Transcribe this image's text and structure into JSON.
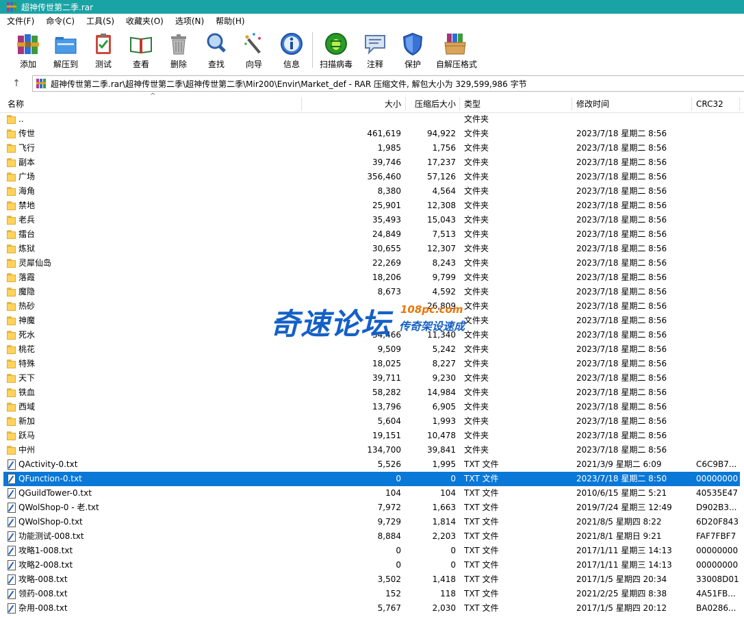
{
  "window": {
    "title": "超神传世第二季.rar"
  },
  "menu": [
    "文件(F)",
    "命令(C)",
    "工具(S)",
    "收藏夹(O)",
    "选项(N)",
    "帮助(H)"
  ],
  "toolbar": {
    "add": "添加",
    "extract_to": "解压到",
    "test": "测试",
    "view": "查看",
    "delete": "删除",
    "find": "查找",
    "wizard": "向导",
    "info": "信息",
    "virus_scan": "扫描病毒",
    "comment": "注释",
    "protect": "保护",
    "sfx": "自解压格式"
  },
  "address": {
    "path": "超神传世第二季.rar\\超神传世第二季\\超神传世第二季\\Mir200\\Envir\\Market_def - RAR 压缩文件, 解包大小为 329,599,986 字节"
  },
  "columns": {
    "name": "名称",
    "size": "大小",
    "packed": "压缩后大小",
    "type": "类型",
    "modified": "修改时间",
    "crc": "CRC32"
  },
  "files": [
    {
      "icon": "folder",
      "name": "..",
      "size": "",
      "packed": "",
      "type": "文件夹",
      "modified": "",
      "crc": ""
    },
    {
      "icon": "folder",
      "name": "传世",
      "size": "461,619",
      "packed": "94,922",
      "type": "文件夹",
      "modified": "2023/7/18 星期二 8:56",
      "crc": ""
    },
    {
      "icon": "folder",
      "name": "飞行",
      "size": "1,985",
      "packed": "1,756",
      "type": "文件夹",
      "modified": "2023/7/18 星期二 8:56",
      "crc": ""
    },
    {
      "icon": "folder",
      "name": "副本",
      "size": "39,746",
      "packed": "17,237",
      "type": "文件夹",
      "modified": "2023/7/18 星期二 8:56",
      "crc": ""
    },
    {
      "icon": "folder",
      "name": "广场",
      "size": "356,460",
      "packed": "57,126",
      "type": "文件夹",
      "modified": "2023/7/18 星期二 8:56",
      "crc": ""
    },
    {
      "icon": "folder",
      "name": "海角",
      "size": "8,380",
      "packed": "4,564",
      "type": "文件夹",
      "modified": "2023/7/18 星期二 8:56",
      "crc": ""
    },
    {
      "icon": "folder",
      "name": "禁地",
      "size": "25,901",
      "packed": "12,308",
      "type": "文件夹",
      "modified": "2023/7/18 星期二 8:56",
      "crc": ""
    },
    {
      "icon": "folder",
      "name": "老兵",
      "size": "35,493",
      "packed": "15,043",
      "type": "文件夹",
      "modified": "2023/7/18 星期二 8:56",
      "crc": ""
    },
    {
      "icon": "folder",
      "name": "擂台",
      "size": "24,849",
      "packed": "7,513",
      "type": "文件夹",
      "modified": "2023/7/18 星期二 8:56",
      "crc": ""
    },
    {
      "icon": "folder",
      "name": "炼狱",
      "size": "30,655",
      "packed": "12,307",
      "type": "文件夹",
      "modified": "2023/7/18 星期二 8:56",
      "crc": ""
    },
    {
      "icon": "folder",
      "name": "灵犀仙岛",
      "size": "22,269",
      "packed": "8,243",
      "type": "文件夹",
      "modified": "2023/7/18 星期二 8:56",
      "crc": ""
    },
    {
      "icon": "folder",
      "name": "落霞",
      "size": "18,206",
      "packed": "9,799",
      "type": "文件夹",
      "modified": "2023/7/18 星期二 8:56",
      "crc": ""
    },
    {
      "icon": "folder",
      "name": "魔隐",
      "size": "8,673",
      "packed": "4,592",
      "type": "文件夹",
      "modified": "2023/7/18 星期二 8:56",
      "crc": ""
    },
    {
      "icon": "folder",
      "name": "热砂",
      "size": "",
      "packed": "26,809",
      "type": "文件夹",
      "modified": "2023/7/18 星期二 8:56",
      "crc": ""
    },
    {
      "icon": "folder",
      "name": "神魔",
      "size": "",
      "packed": "",
      "type": "文件夹",
      "modified": "2023/7/18 星期二 8:56",
      "crc": ""
    },
    {
      "icon": "folder",
      "name": "死水",
      "size": "34,466",
      "packed": "11,340",
      "type": "文件夹",
      "modified": "2023/7/18 星期二 8:56",
      "crc": ""
    },
    {
      "icon": "folder",
      "name": "桃花",
      "size": "9,509",
      "packed": "5,242",
      "type": "文件夹",
      "modified": "2023/7/18 星期二 8:56",
      "crc": ""
    },
    {
      "icon": "folder",
      "name": "特殊",
      "size": "18,025",
      "packed": "8,227",
      "type": "文件夹",
      "modified": "2023/7/18 星期二 8:56",
      "crc": ""
    },
    {
      "icon": "folder",
      "name": "天下",
      "size": "39,711",
      "packed": "9,230",
      "type": "文件夹",
      "modified": "2023/7/18 星期二 8:56",
      "crc": ""
    },
    {
      "icon": "folder",
      "name": "铁血",
      "size": "58,282",
      "packed": "14,984",
      "type": "文件夹",
      "modified": "2023/7/18 星期二 8:56",
      "crc": ""
    },
    {
      "icon": "folder",
      "name": "西域",
      "size": "13,796",
      "packed": "6,905",
      "type": "文件夹",
      "modified": "2023/7/18 星期二 8:56",
      "crc": ""
    },
    {
      "icon": "folder",
      "name": "新加",
      "size": "5,604",
      "packed": "1,993",
      "type": "文件夹",
      "modified": "2023/7/18 星期二 8:56",
      "crc": ""
    },
    {
      "icon": "folder",
      "name": "跃马",
      "size": "19,151",
      "packed": "10,478",
      "type": "文件夹",
      "modified": "2023/7/18 星期二 8:56",
      "crc": ""
    },
    {
      "icon": "folder",
      "name": "中州",
      "size": "134,700",
      "packed": "39,841",
      "type": "文件夹",
      "modified": "2023/7/18 星期二 8:56",
      "crc": ""
    },
    {
      "icon": "txt",
      "name": "QActivity-0.txt",
      "size": "5,526",
      "packed": "1,995",
      "type": "TXT 文件",
      "modified": "2021/3/9 星期二 6:09",
      "crc": "C6C9B7..."
    },
    {
      "icon": "txt",
      "name": "QFunction-0.txt",
      "size": "0",
      "packed": "0",
      "type": "TXT 文件",
      "modified": "2023/7/18 星期二 8:50",
      "crc": "00000000",
      "selected": true
    },
    {
      "icon": "txt",
      "name": "QGuildTower-0.txt",
      "size": "104",
      "packed": "104",
      "type": "TXT 文件",
      "modified": "2010/6/15 星期二 5:21",
      "crc": "40535E47"
    },
    {
      "icon": "txt",
      "name": "QWolShop-0 - 老.txt",
      "size": "7,972",
      "packed": "1,663",
      "type": "TXT 文件",
      "modified": "2019/7/24 星期三 12:49",
      "crc": "D902B3..."
    },
    {
      "icon": "txt",
      "name": "QWolShop-0.txt",
      "size": "9,729",
      "packed": "1,814",
      "type": "TXT 文件",
      "modified": "2021/8/5 星期四 8:22",
      "crc": "6D20F843"
    },
    {
      "icon": "txt",
      "name": "功能测试-008.txt",
      "size": "8,884",
      "packed": "2,203",
      "type": "TXT 文件",
      "modified": "2021/8/1 星期日 9:21",
      "crc": "FAF7FBF7"
    },
    {
      "icon": "txt",
      "name": "攻略1-008.txt",
      "size": "0",
      "packed": "0",
      "type": "TXT 文件",
      "modified": "2017/1/11 星期三 14:13",
      "crc": "00000000"
    },
    {
      "icon": "txt",
      "name": "攻略2-008.txt",
      "size": "0",
      "packed": "0",
      "type": "TXT 文件",
      "modified": "2017/1/11 星期三 14:13",
      "crc": "00000000"
    },
    {
      "icon": "txt",
      "name": "攻略-008.txt",
      "size": "3,502",
      "packed": "1,418",
      "type": "TXT 文件",
      "modified": "2017/1/5 星期四 20:34",
      "crc": "33008D01"
    },
    {
      "icon": "txt",
      "name": "领药-008.txt",
      "size": "152",
      "packed": "118",
      "type": "TXT 文件",
      "modified": "2021/2/25 星期四 8:38",
      "crc": "4A51FB..."
    },
    {
      "icon": "txt",
      "name": "杂用-008.txt",
      "size": "5,767",
      "packed": "2,030",
      "type": "TXT 文件",
      "modified": "2017/1/5 星期四 20:12",
      "crc": "BA0286..."
    }
  ],
  "watermark": {
    "main": "奇速论坛",
    "url": "108pc.com",
    "sub": "传奇架设速成"
  }
}
